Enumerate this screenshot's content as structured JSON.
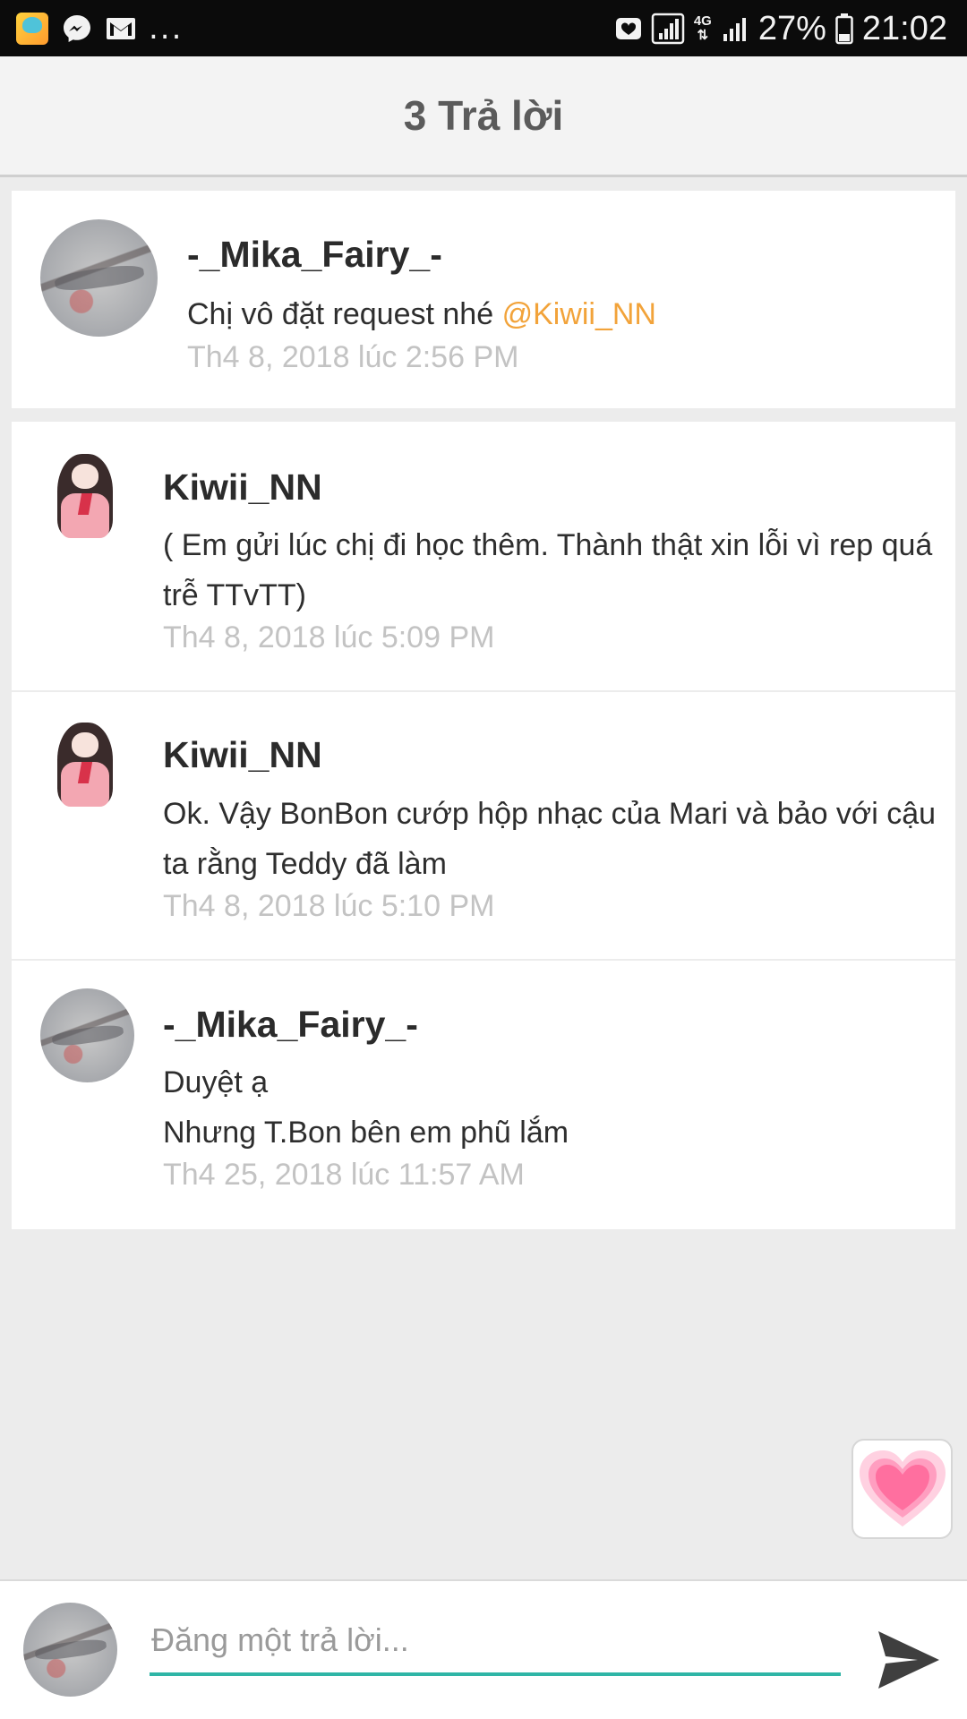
{
  "status_bar": {
    "overflow": "...",
    "network": "4G",
    "battery": "27%",
    "time": "21:02"
  },
  "header": {
    "title": "3 Trả lời"
  },
  "replies": [
    {
      "author": "-_Mika_Fairy_-",
      "text": "Chị vô đặt request nhé ",
      "mention": "@Kiwii_NN",
      "timestamp": "Th4 8, 2018 lúc 2:56 PM"
    },
    {
      "author": "Kiwii_NN",
      "text": "( Em gửi lúc chị đi học thêm. Thành thật xin lỗi vì rep quá trễ TTvTT)",
      "timestamp": "Th4 8, 2018 lúc 5:09 PM"
    },
    {
      "author": "Kiwii_NN",
      "text": "Ok. Vậy BonBon cướp hộp nhạc của Mari và bảo với cậu ta rằng Teddy đã  làm",
      "timestamp": "Th4 8, 2018 lúc 5:10 PM"
    },
    {
      "author": "-_Mika_Fairy_-",
      "text_line1": "Duyệt ạ",
      "text_line2": "Nhưng T.Bon bên em phũ lắm",
      "timestamp": "Th4 25, 2018 lúc 11:57 AM"
    }
  ],
  "composer": {
    "placeholder": "Đăng một trả lời...",
    "value": ""
  },
  "colors": {
    "mention": "#f2a33a",
    "input_underline": "#2fb5a6",
    "heart": "#ff7aa8",
    "timestamp": "#c3c3c3"
  },
  "icons": {
    "like": "heart-icon",
    "send": "send-icon"
  }
}
